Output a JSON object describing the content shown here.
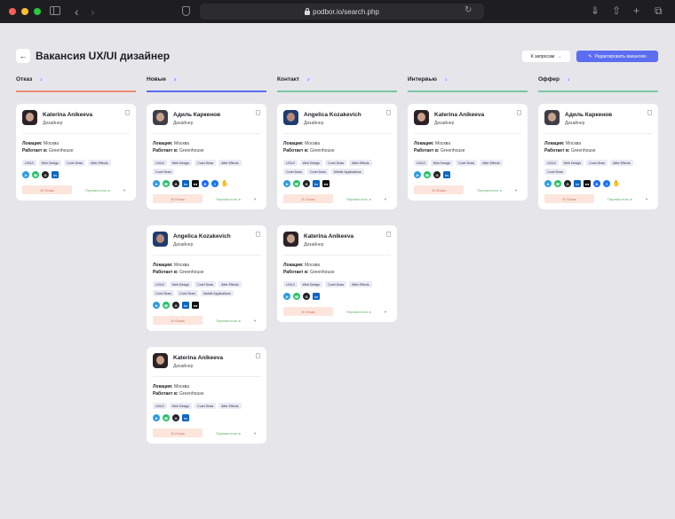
{
  "browser": {
    "url": "podbor.io/search.php",
    "dot_colors": [
      "#ff5f57",
      "#febc2e",
      "#28c840"
    ]
  },
  "page": {
    "title": "Вакансия UX/UI дизайнер",
    "requests_button": "К запросам",
    "edit_button": "Редактировать вакансию"
  },
  "columns": [
    {
      "title": "Отказ",
      "count": "1",
      "accent": "#f08b72"
    },
    {
      "title": "Новые",
      "count": "3",
      "accent": "#5b6df0"
    },
    {
      "title": "Контакт",
      "count": "2",
      "accent": "#78c7a0"
    },
    {
      "title": "Интервью",
      "count": "1",
      "accent": "#78c7a0"
    },
    {
      "title": "Оффер",
      "count": "1",
      "accent": "#78c7a0"
    }
  ],
  "labels": {
    "location": "Локация:",
    "works_at": "Работает в:",
    "reject": "Отказ",
    "move": "Переместить в"
  },
  "cards": [
    {
      "name": "Katerina Anikeeva",
      "role": "Дизайнер",
      "location": "Москва",
      "company": "Greenhouse",
      "tags": [
        "UX/UI",
        "Web Design",
        "Corel Draw",
        "After Effects"
      ],
      "socials": [
        "telegram",
        "whatsapp",
        "github",
        "linkedin"
      ]
    },
    {
      "name": "Адиль Каркенов",
      "role": "Дизайнер",
      "location": "Москва",
      "company": "Greenhouse",
      "tags": [
        "UX/UI",
        "Web Design",
        "Corel Draw",
        "After Effects",
        "Corel Draw"
      ],
      "socials": [
        "telegram",
        "whatsapp",
        "github",
        "linkedin",
        "medium",
        "behance",
        "facebook",
        "hand"
      ]
    },
    {
      "name": "Angelica Kozakevich",
      "role": "Дизайнер",
      "location": "Москва",
      "company": "Greenhouse",
      "tags": [
        "UX/UI",
        "Web Design",
        "Corel Draw",
        "After Effects",
        "Corel Draw",
        "Corel Draw",
        "Mobile Applications"
      ],
      "socials": [
        "telegram",
        "whatsapp",
        "github",
        "linkedin",
        "medium"
      ]
    },
    {
      "name": "Katerina Anikeeva",
      "role": "Дизайнер",
      "location": "Москва",
      "company": "Greenhouse",
      "tags": [
        "UX/UI",
        "Web Design",
        "Corel Draw",
        "After Effects"
      ],
      "socials": [
        "telegram",
        "whatsapp",
        "github",
        "linkedin"
      ]
    },
    {
      "name": "Адиль Каркенов",
      "role": "Дизайнер",
      "location": "Москва",
      "company": "Greenhouse",
      "tags": [
        "UX/UI",
        "Web Design",
        "Corel Draw",
        "After Effects",
        "Corel Draw"
      ],
      "socials": [
        "telegram",
        "whatsapp",
        "github",
        "linkedin",
        "medium",
        "behance",
        "facebook",
        "hand"
      ]
    },
    {
      "name": "Angelica Kozakevich",
      "role": "Дизайнер",
      "location": "Москва",
      "company": "Greenhouse",
      "tags": [
        "UX/UI",
        "Web Design",
        "Corel Draw",
        "After Effects",
        "Corel Draw",
        "Corel Draw",
        "Mobile Applications"
      ],
      "socials": [
        "telegram",
        "whatsapp",
        "github",
        "linkedin",
        "medium"
      ]
    },
    {
      "name": "Katerina Anikeeva",
      "role": "Дизайнер",
      "location": "Москва",
      "company": "Greenhouse",
      "tags": [
        "UX/UI",
        "Web Design",
        "Corel Draw",
        "After Effects"
      ],
      "socials": [
        "telegram",
        "whatsapp",
        "github",
        "linkedin"
      ]
    },
    {
      "name": "Katerina Anikeeva",
      "role": "Дизайнер",
      "location": "Москва",
      "company": "Greenhouse",
      "tags": [
        "UX/UI",
        "Web Design",
        "Corel Draw",
        "After Effects"
      ],
      "socials": [
        "telegram",
        "whatsapp",
        "github",
        "linkedin"
      ]
    }
  ]
}
